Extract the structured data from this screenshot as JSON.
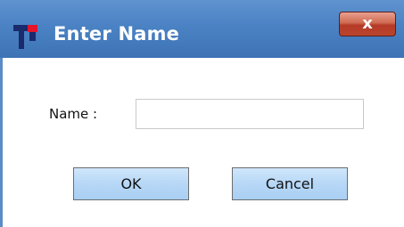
{
  "window": {
    "title": "Enter Name",
    "close_glyph": "x",
    "icon": "app-logo-icon"
  },
  "form": {
    "name_label": "Name :",
    "name_value": "",
    "name_placeholder": ""
  },
  "buttons": {
    "ok_label": "OK",
    "cancel_label": "Cancel"
  },
  "colors": {
    "titlebar": "#4a82c4",
    "close_button": "#c0503a",
    "button_face": "#b7d7f6"
  }
}
